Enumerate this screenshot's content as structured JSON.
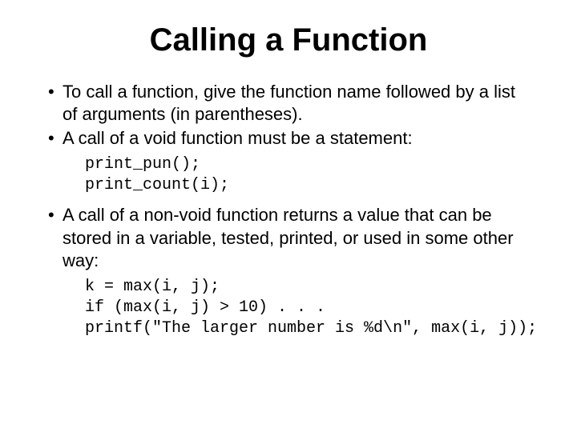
{
  "title": "Calling a Function",
  "bullets": {
    "b1": "To call a function, give the function name followed by a list of arguments (in parentheses).",
    "b2": "A call of a void function must be a statement:",
    "b3": "A call of a non-void function returns a value that can be stored in a variable, tested, printed, or used in some other way:"
  },
  "code": {
    "c1": "print_pun();\nprint_count(i);",
    "c2": "k = max(i, j);\nif (max(i, j) > 10) . . .\nprintf(\"The larger number is %d\\n\", max(i, j));"
  }
}
